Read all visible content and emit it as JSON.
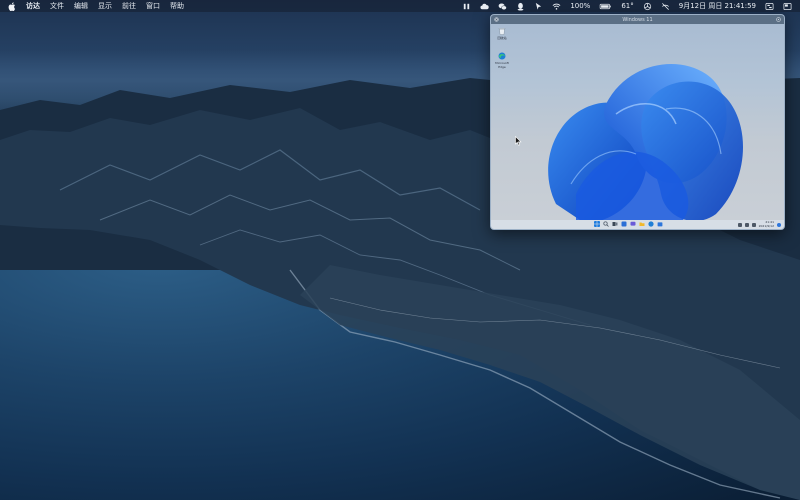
{
  "menubar": {
    "apple_icon": "apple-logo-icon",
    "app_name": "访达",
    "menus": [
      "文件",
      "编辑",
      "显示",
      "前往",
      "窗口",
      "帮助"
    ],
    "status": {
      "battery": "100%",
      "temperature": "61°",
      "datetime": "9月12日 周日 21:41:59"
    }
  },
  "vm_window": {
    "title": "Windows 11",
    "desktop_icons": [
      {
        "label": "回收站",
        "icon": "recycle-bin-icon"
      },
      {
        "label": "Microsoft Edge",
        "icon": "edge-icon"
      }
    ],
    "taskbar": {
      "clock_time": "21:41",
      "clock_date": "2021/9/12"
    }
  }
}
